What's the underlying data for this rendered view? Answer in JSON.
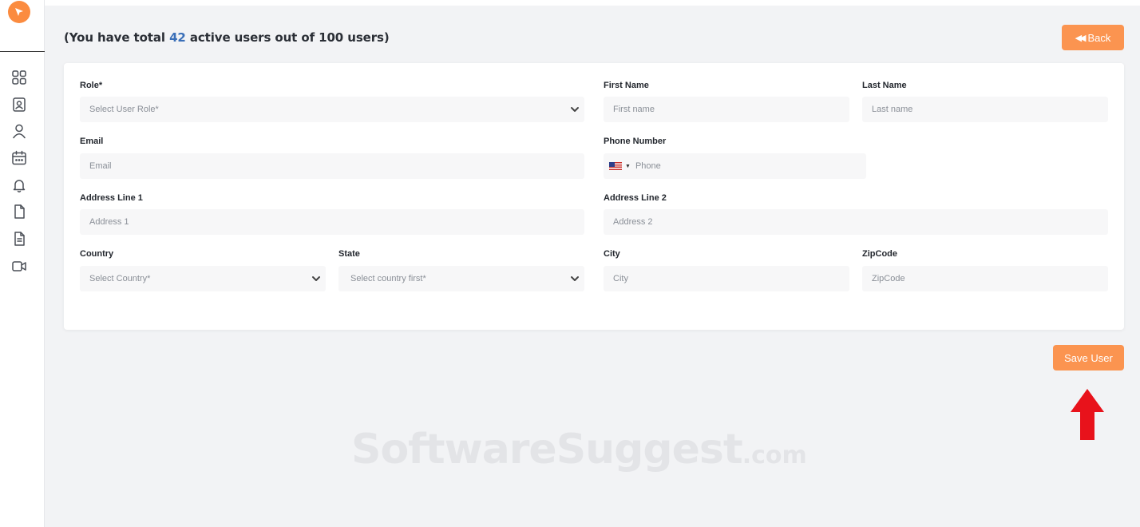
{
  "header": {
    "summary_prefix": "(You have total ",
    "active_count": "42",
    "summary_suffix": " active users out of 100 users)",
    "back_label": "Back",
    "back_icon": "double-chevron-left-icon"
  },
  "sidebar": {
    "items": [
      {
        "icon": "dashboard-grid-icon"
      },
      {
        "icon": "contact-card-icon"
      },
      {
        "icon": "user-icon"
      },
      {
        "icon": "calendar-icon"
      },
      {
        "icon": "bell-icon"
      },
      {
        "icon": "file-icon"
      },
      {
        "icon": "document-icon"
      },
      {
        "icon": "video-camera-icon"
      }
    ]
  },
  "form": {
    "role": {
      "label": "Role*",
      "placeholder": "Select User Role*"
    },
    "first_name": {
      "label": "First Name",
      "placeholder": "First name"
    },
    "last_name": {
      "label": "Last Name",
      "placeholder": "Last name"
    },
    "email": {
      "label": "Email",
      "placeholder": "Email"
    },
    "phone": {
      "label": "Phone Number",
      "placeholder": "Phone",
      "country_flag": "us-flag-icon"
    },
    "address1": {
      "label": "Address Line 1",
      "placeholder": "Address 1"
    },
    "address2": {
      "label": "Address Line 2",
      "placeholder": "Address 2"
    },
    "country": {
      "label": "Country",
      "placeholder": "Select Country*"
    },
    "state": {
      "label": "State",
      "placeholder": "Select country first*"
    },
    "city": {
      "label": "City",
      "placeholder": "City"
    },
    "zipcode": {
      "label": "ZipCode",
      "placeholder": "ZipCode"
    }
  },
  "actions": {
    "save_label": "Save User"
  },
  "watermark": {
    "main": "SoftwareSuggest",
    "suffix": ".com"
  },
  "colors": {
    "accent": "#fb9450",
    "count_highlight": "#3a6fb8",
    "annotation_arrow": "#e8121b"
  }
}
